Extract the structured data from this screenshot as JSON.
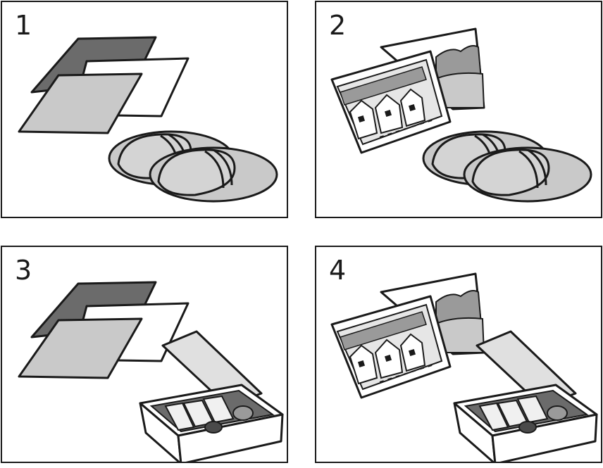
{
  "panels": [
    {
      "number": "1",
      "items": [
        "towel-sheets",
        "slippers"
      ]
    },
    {
      "number": "2",
      "items": [
        "postcards",
        "slippers"
      ]
    },
    {
      "number": "3",
      "items": [
        "towel-sheets",
        "lunch-box"
      ]
    },
    {
      "number": "4",
      "items": [
        "postcards",
        "lunch-box"
      ]
    }
  ],
  "colors": {
    "outline": "#1a1a1a",
    "dark_gray": "#6b6b6b",
    "light_gray": "#c9c9c9",
    "mid_gray": "#9a9a9a"
  }
}
